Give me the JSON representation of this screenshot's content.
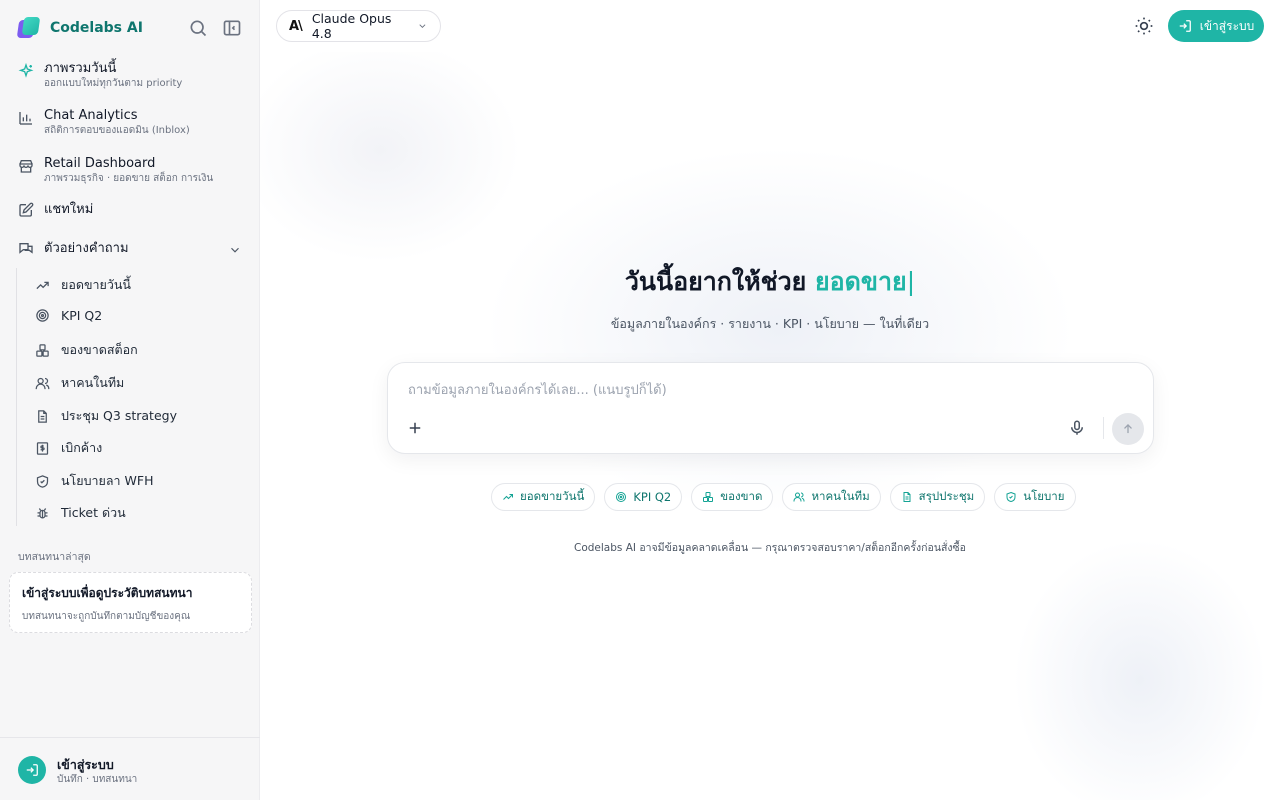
{
  "brand": {
    "name": "Codelabs AI"
  },
  "sidebar": {
    "nav": [
      {
        "title": "ภาพรวมวันนี้",
        "subtitle": "ออกแบบใหม่ทุกวันตาม priority",
        "icon": "sparkle-icon"
      },
      {
        "title": "Chat Analytics",
        "subtitle": "สถิติการตอบของแอดมิน (Inblox)",
        "icon": "bar-chart-icon"
      },
      {
        "title": "Retail Dashboard",
        "subtitle": "ภาพรวมธุรกิจ · ยอดขาย สต็อก การเงิน",
        "icon": "store-icon"
      },
      {
        "title": "แชทใหม่",
        "icon": "edit-icon"
      },
      {
        "title": "ตัวอย่างคำถาม",
        "icon": "chat-bubbles-icon"
      }
    ],
    "examples": [
      {
        "label": "ยอดขายวันนี้",
        "icon": "trending-up-icon"
      },
      {
        "label": "KPI Q2",
        "icon": "target-icon"
      },
      {
        "label": "ของขาดสต็อก",
        "icon": "boxes-icon"
      },
      {
        "label": "หาคนในทีม",
        "icon": "users-icon"
      },
      {
        "label": "ประชุม Q3 strategy",
        "icon": "document-icon"
      },
      {
        "label": "เบิกค้าง",
        "icon": "receipt-icon"
      },
      {
        "label": "นโยบายลา WFH",
        "icon": "shield-icon"
      },
      {
        "label": "Ticket ด่วน",
        "icon": "bug-icon"
      }
    ],
    "recent_label": "บทสนทนาล่าสุด",
    "login_card": {
      "title": "เข้าสู่ระบบเพื่อดูประวัติบทสนทนา",
      "subtitle": "บทสนทนาจะถูกบันทึกตามบัญชีของคุณ"
    },
    "footer": {
      "title": "เข้าสู่ระบบ",
      "subtitle": "บันทึก · บทสนทนา"
    }
  },
  "topbar": {
    "model_logo": "A\\",
    "model_name": "Claude Opus 4.8",
    "login_label": "เข้าสู่ระบบ"
  },
  "hero": {
    "title_prefix": "วันนี้อยากให้ช่วย",
    "title_accent": "ยอดขาย",
    "caret": "|",
    "subtitle": "ข้อมูลภายในองค์กร · รายงาน · KPI · นโยบาย — ในที่เดียว"
  },
  "composer": {
    "placeholder": "ถามข้อมูลภายในองค์กรได้เลย... (แนบรูปก็ได้)",
    "value": ""
  },
  "chips": [
    {
      "label": "ยอดขายวันนี้",
      "icon": "trending-up-icon"
    },
    {
      "label": "KPI Q2",
      "icon": "target-icon"
    },
    {
      "label": "ของขาด",
      "icon": "boxes-icon"
    },
    {
      "label": "หาคนในทีม",
      "icon": "users-icon"
    },
    {
      "label": "สรุปประชุม",
      "icon": "document-icon"
    },
    {
      "label": "นโยบาย",
      "icon": "shield-icon"
    }
  ],
  "disclaimer": "Codelabs AI อาจมีข้อมูลคลาดเคลื่อน — กรุณาตรวจสอบราคา/สต็อกอีกครั้งก่อนสั่งซื้อ",
  "colors": {
    "accent": "#1fb5a6",
    "accent_dark": "#0f766e",
    "sidebar_bg": "#f6f6f7"
  }
}
